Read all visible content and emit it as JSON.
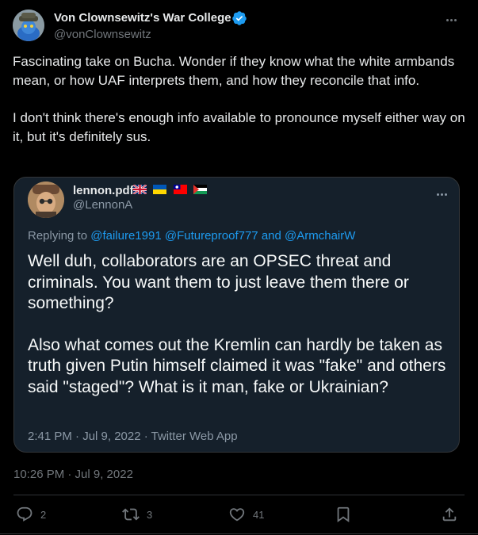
{
  "tweet": {
    "author_name": "Von Clownsewitz's War College",
    "handle": "@vonClownsewitz",
    "text_paragraphs": [
      "Fascinating take on Bucha. Wonder if they know what the white armbands mean, or how UAF interprets them, and how they reconcile that info.",
      "I don't think there's enough info available to pronounce myself either way on it, but it's definitely sus."
    ],
    "timestamp": "10:26 PM · Jul 9, 2022"
  },
  "quoted": {
    "author_name": "lennon.pdf",
    "handle": "@LennonA",
    "replying_prefix": "Replying to",
    "mention_1": "@failure1991",
    "mention_2": "@Futureproof777",
    "and_word": "and",
    "mention_3": "@ArmchairW",
    "text_paragraphs": [
      "Well duh, collaborators are an OPSEC threat and criminals. You want them to just leave them there or something?",
      "Also what comes out the Kremlin can hardly be taken as truth given Putin himself claimed it was \"fake\" and others said \"staged\"? What is it man, fake or Ukrainian?"
    ],
    "meta": "2:41 PM · Jul 9, 2022 · Twitter Web App",
    "flags": [
      "uk-flag-icon",
      "ukraine-flag-icon",
      "taiwan-flag-icon",
      "palestine-flag-icon"
    ]
  },
  "actions": {
    "replies": "2",
    "retweets": "3",
    "likes": "41"
  },
  "colors": {
    "background": "#000000",
    "quote_background": "#15202b",
    "link": "#1d9bf0",
    "muted": "#71767b"
  }
}
